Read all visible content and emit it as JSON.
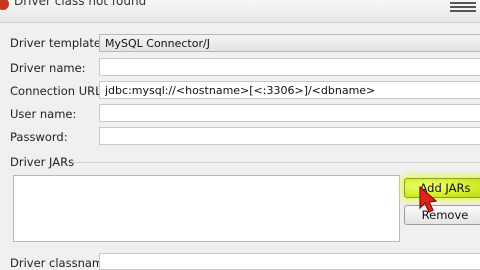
{
  "window": {
    "title": "Driver class not found"
  },
  "form": {
    "template_label": "Driver template:",
    "template_value": "MySQL Connector/J",
    "name_label": "Driver name:",
    "name_value": "",
    "url_label": "Connection URL:",
    "url_value": "jdbc:mysql://<hostname>[<:3306>]/<dbname>",
    "user_label": "User name:",
    "user_value": "",
    "password_label": "Password:",
    "password_value": "",
    "jars_label": "Driver JARs",
    "classname_label": "Driver classname:"
  },
  "buttons": {
    "add_jars": "Add JARs",
    "remove": "Remove"
  },
  "colors": {
    "error_icon": "#c7361e",
    "highlight": "#e4f53a",
    "cursor": "#e0221b"
  }
}
